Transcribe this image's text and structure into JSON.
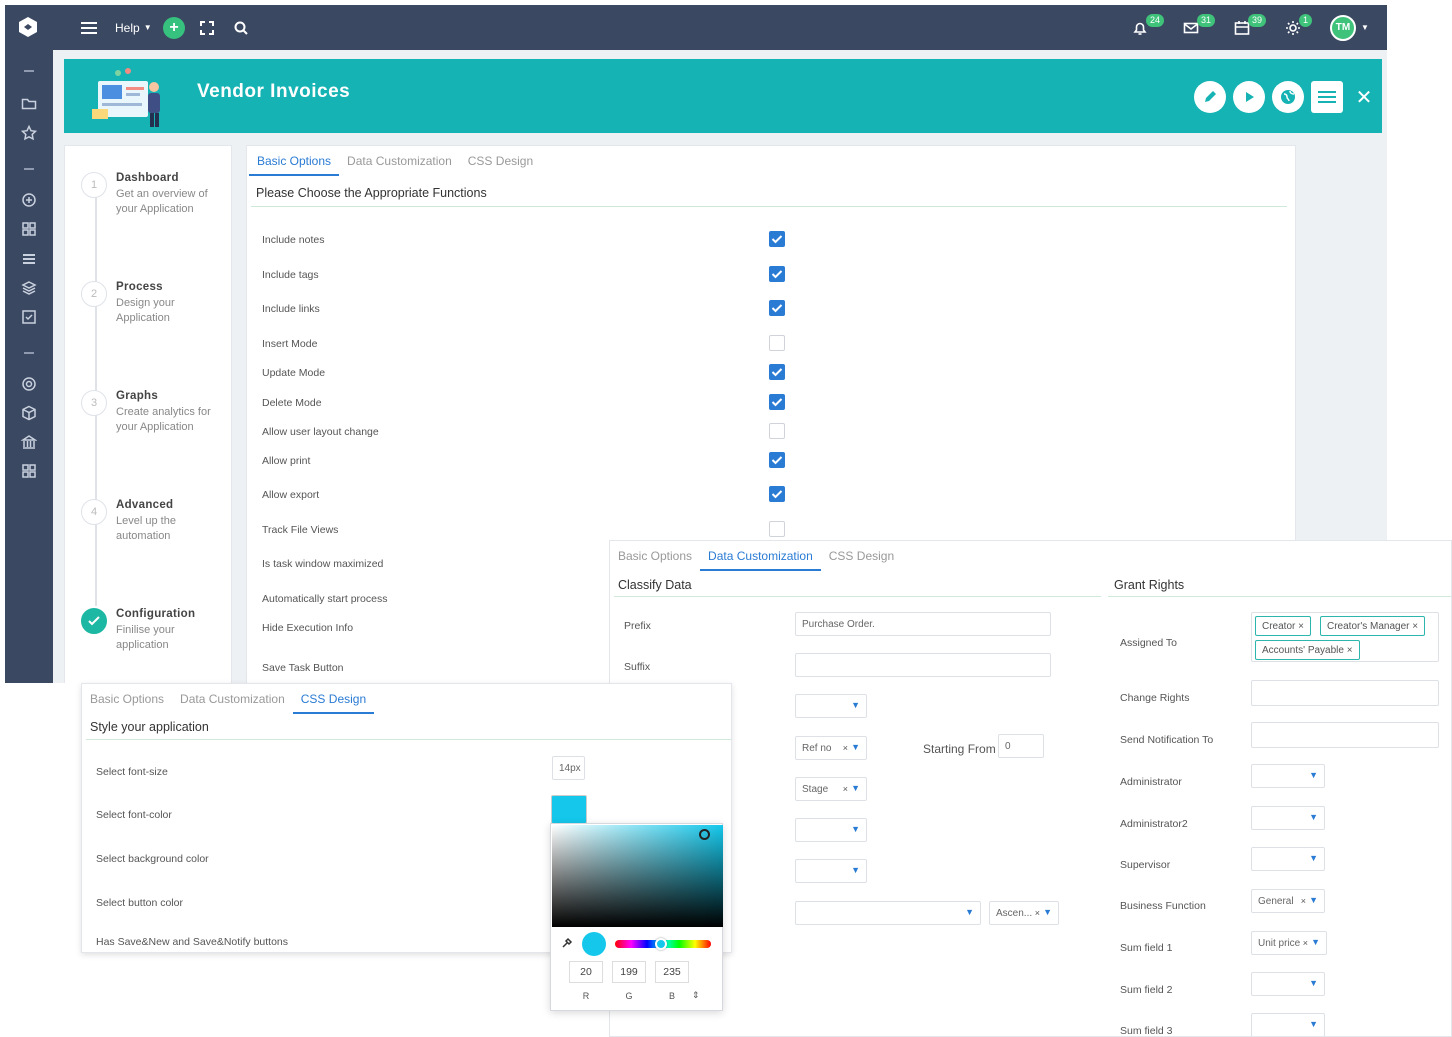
{
  "topbar": {
    "help_label": "Help",
    "badges": {
      "notifications": "24",
      "messages": "31",
      "calendar": "39",
      "tasks": "1"
    },
    "avatar": "TM"
  },
  "header": {
    "title": "Vendor Invoices"
  },
  "steps": [
    {
      "num": "1",
      "title": "Dashboard",
      "desc": "Get an overview of your Application"
    },
    {
      "num": "2",
      "title": "Process",
      "desc": "Design your Application"
    },
    {
      "num": "3",
      "title": "Graphs",
      "desc": "Create analytics for your Application"
    },
    {
      "num": "4",
      "title": "Advanced",
      "desc": "Level up the automation"
    },
    {
      "num": "",
      "title": "Configuration",
      "desc": "Finilise your application"
    }
  ],
  "tabs": {
    "basic": "Basic Options",
    "data": "Data Customization",
    "css": "CSS Design"
  },
  "basic": {
    "section": "Please Choose the Appropriate Functions",
    "options": [
      {
        "label": "Include notes",
        "checked": true
      },
      {
        "label": "Include tags",
        "checked": true
      },
      {
        "label": "Include links",
        "checked": true
      },
      {
        "label": "Insert Mode",
        "checked": false
      },
      {
        "label": "Update Mode",
        "checked": true
      },
      {
        "label": "Delete Mode",
        "checked": true
      },
      {
        "label": "Allow user layout change",
        "checked": false
      },
      {
        "label": "Allow print",
        "checked": true
      },
      {
        "label": "Allow export",
        "checked": true
      },
      {
        "label": "Track File Views",
        "checked": false
      },
      {
        "label": "Is task window maximized",
        "checked": null
      },
      {
        "label": "Automatically start process",
        "checked": null
      },
      {
        "label": "Hide Execution Info",
        "checked": null
      },
      {
        "label": "Save Task Button",
        "checked": null
      }
    ]
  },
  "data": {
    "classify": "Classify Data",
    "grant": "Grant Rights",
    "prefix_label": "Prefix",
    "prefix_value": "Purchase Order.",
    "suffix_label": "Suffix",
    "refno": "Ref no",
    "starting_from": "Starting From",
    "starting_value": "0",
    "stage": "Stage",
    "ascending": "Ascen...",
    "rights": {
      "assigned_to": "Assigned To",
      "tags": [
        "Creator",
        "Creator's Manager",
        "Accounts' Payable"
      ],
      "change_rights": "Change Rights",
      "send_notification": "Send Notification To",
      "administrator": "Administrator",
      "administrator2": "Administrator2",
      "supervisor": "Supervisor",
      "business_function": "Business Function",
      "business_value": "General",
      "sum1": "Sum field 1",
      "sum1_value": "Unit price",
      "sum2": "Sum field 2",
      "sum3": "Sum field 3"
    }
  },
  "css": {
    "section": "Style your application",
    "font_size_label": "Select font-size",
    "font_size_value": "14px",
    "font_color_label": "Select font-color",
    "bg_color_label": "Select background color",
    "btn_color_label": "Select button color",
    "save_label": "Has Save&New and Save&Notify buttons",
    "selected_color": "#14c7eb",
    "picker": {
      "r": "20",
      "g": "199",
      "b": "235",
      "r_label": "R",
      "g_label": "G",
      "b_label": "B"
    }
  },
  "colors": {
    "accent": "#2a7bd4",
    "header": "#15b3b3",
    "nav": "#3b4862",
    "success": "#3fc27a"
  }
}
